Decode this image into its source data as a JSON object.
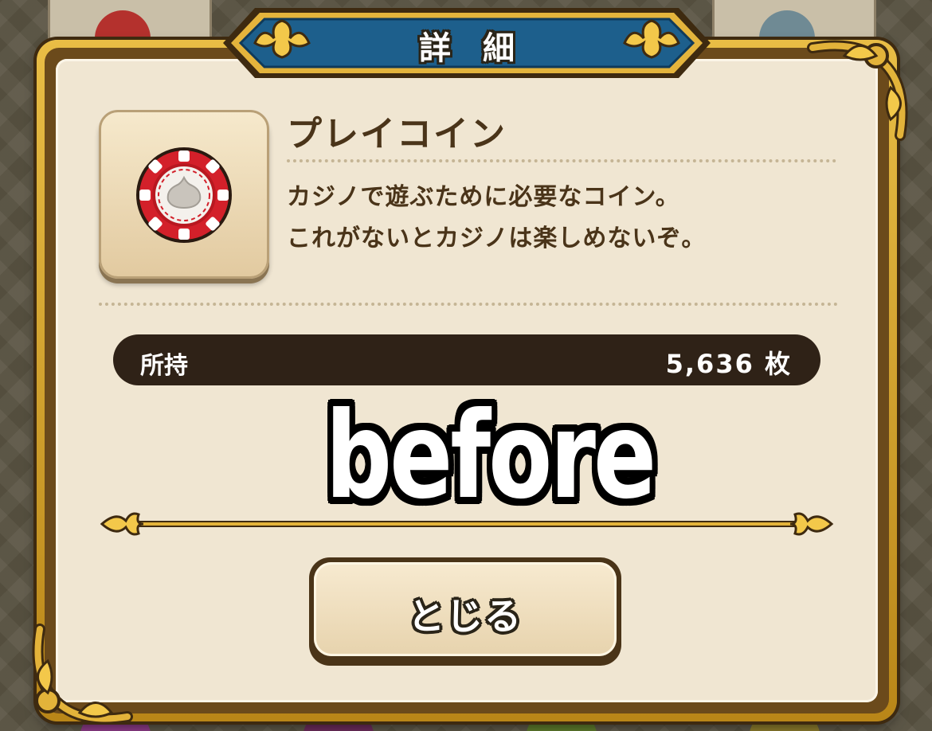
{
  "dialog": {
    "title": "詳細"
  },
  "item": {
    "name": "プレイコイン",
    "icon": "casino-chip-icon",
    "description_line1": "カジノで遊ぶために必要なコイン。",
    "description_line2": "これがないとカジノは楽しめないぞ。"
  },
  "owned": {
    "label": "所持",
    "value": "5,636 枚"
  },
  "overlay": {
    "caption": "before"
  },
  "buttons": {
    "close_label": "とじる"
  },
  "colors": {
    "frame_gold": "#d9a32c",
    "ribbon_blue": "#1d5f8c",
    "panel_bg": "#f0e6d2",
    "text_brown": "#4a3419",
    "owned_bar": "#2f2217",
    "chip_red": "#d3202a"
  }
}
